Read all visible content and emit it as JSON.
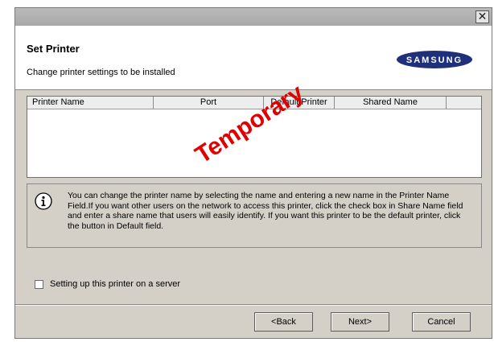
{
  "header": {
    "title": "Set Printer",
    "subtitle": "Change printer settings to be installed",
    "logo_text": "SAMSUNG"
  },
  "table": {
    "columns": [
      "Printer Name",
      "Port",
      "Default Printer",
      "Shared Name"
    ]
  },
  "watermark": "Temporary",
  "info": {
    "text": "You can change the printer name by selecting the name and entering a new name in the Printer Name Field.If you want other users on the network to access this printer, click the check box in Share Name field and enter a share name that users will easily identify. If you want this printer to be the default printer, click the button in Default field."
  },
  "server_checkbox": {
    "label": "Setting up this printer on a server",
    "checked": false
  },
  "buttons": {
    "back": "<Back",
    "next": "Next>",
    "cancel": "Cancel"
  },
  "close_glyph": "✕",
  "colors": {
    "watermark": "#e00000",
    "logo_bg": "#1f2f7a"
  }
}
